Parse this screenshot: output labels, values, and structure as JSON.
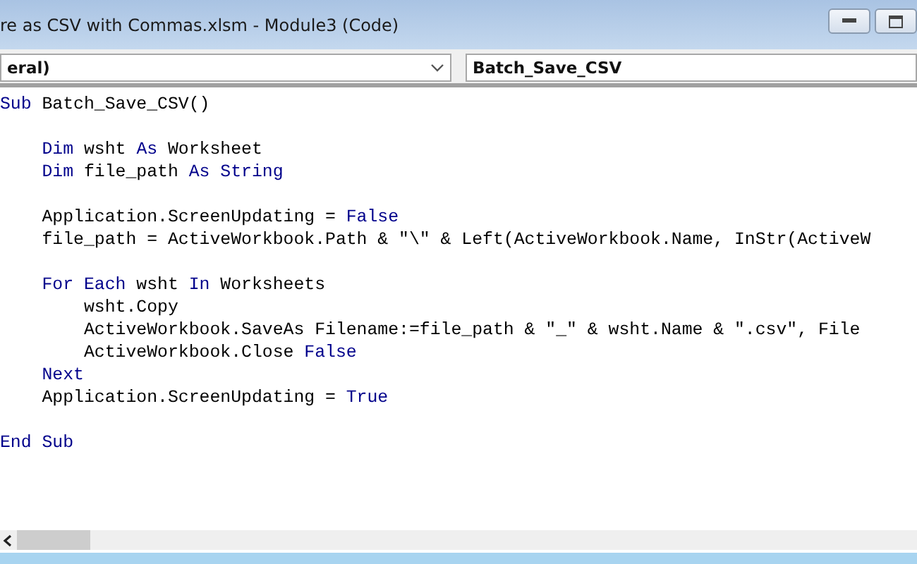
{
  "window": {
    "title": "re as CSV with Commas.xlsm - Module3 (Code)"
  },
  "object_dropdown": {
    "value": "eral)"
  },
  "procedure_dropdown": {
    "value": "Batch_Save_CSV"
  },
  "code_lines": [
    {
      "kind": "code",
      "tokens": [
        {
          "text": "Sub",
          "kind": "keyword"
        },
        {
          "text": " Batch_Save_CSV()",
          "kind": "plain"
        }
      ]
    },
    {
      "kind": "blank"
    },
    {
      "kind": "code",
      "tokens": [
        {
          "text": "    Dim",
          "kind": "keyword"
        },
        {
          "text": " wsht ",
          "kind": "plain"
        },
        {
          "text": "As",
          "kind": "keyword"
        },
        {
          "text": " Worksheet",
          "kind": "plain"
        }
      ]
    },
    {
      "kind": "code",
      "tokens": [
        {
          "text": "    Dim",
          "kind": "keyword"
        },
        {
          "text": " file_path ",
          "kind": "plain"
        },
        {
          "text": "As String",
          "kind": "keyword"
        }
      ]
    },
    {
      "kind": "blank"
    },
    {
      "kind": "code",
      "tokens": [
        {
          "text": "    Application.ScreenUpdating = ",
          "kind": "plain"
        },
        {
          "text": "False",
          "kind": "keyword"
        }
      ]
    },
    {
      "kind": "code",
      "tokens": [
        {
          "text": "    file_path = ActiveWorkbook.Path & \"\\\" & Left(ActiveWorkbook.Name, InStr(ActiveW",
          "kind": "plain"
        }
      ]
    },
    {
      "kind": "blank"
    },
    {
      "kind": "code",
      "tokens": [
        {
          "text": "    For Each",
          "kind": "keyword"
        },
        {
          "text": " wsht ",
          "kind": "plain"
        },
        {
          "text": "In",
          "kind": "keyword"
        },
        {
          "text": " Worksheets",
          "kind": "plain"
        }
      ]
    },
    {
      "kind": "code",
      "tokens": [
        {
          "text": "        wsht.Copy",
          "kind": "plain"
        }
      ]
    },
    {
      "kind": "code",
      "tokens": [
        {
          "text": "        ActiveWorkbook.SaveAs Filename:=file_path & \"_\" & wsht.Name & \".csv\", File",
          "kind": "plain"
        }
      ]
    },
    {
      "kind": "code",
      "tokens": [
        {
          "text": "        ActiveWorkbook.Close ",
          "kind": "plain"
        },
        {
          "text": "False",
          "kind": "keyword"
        }
      ]
    },
    {
      "kind": "code",
      "tokens": [
        {
          "text": "    Next",
          "kind": "keyword"
        }
      ]
    },
    {
      "kind": "code",
      "tokens": [
        {
          "text": "    Application.ScreenUpdating = ",
          "kind": "plain"
        },
        {
          "text": "True",
          "kind": "keyword"
        }
      ]
    },
    {
      "kind": "blank"
    },
    {
      "kind": "code",
      "tokens": [
        {
          "text": "End Sub",
          "kind": "keyword"
        }
      ]
    }
  ]
}
